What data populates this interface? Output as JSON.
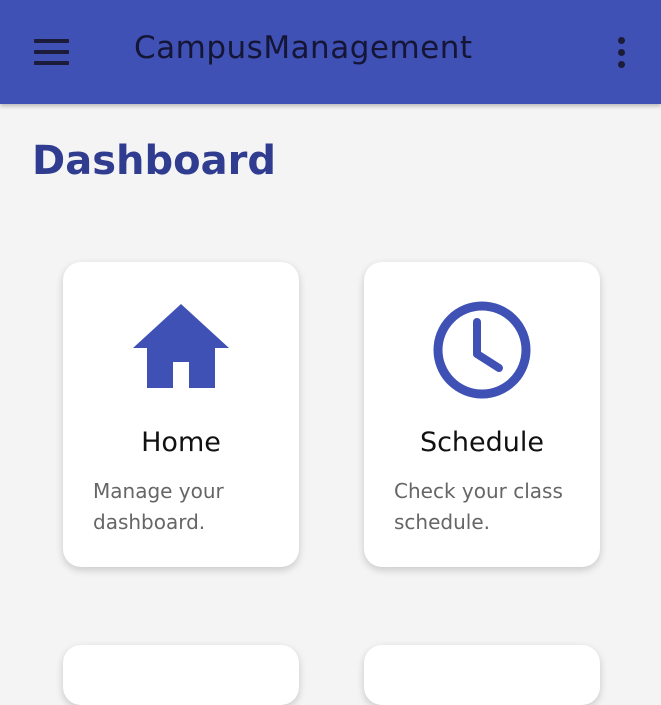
{
  "app_bar": {
    "title": "CampusManagement",
    "menu_icon": "menu-icon",
    "overflow_icon": "more-vert-icon"
  },
  "page": {
    "title": "Dashboard"
  },
  "cards": [
    {
      "title": "Home",
      "description": "Manage your dashboard.",
      "icon": "home-icon"
    },
    {
      "title": "Schedule",
      "description": "Check your class schedule.",
      "icon": "clock-icon"
    }
  ],
  "colors": {
    "primary": "#3f51b5",
    "title_text": "#2f3c8f",
    "background": "#f4f4f4",
    "card": "#ffffff"
  }
}
